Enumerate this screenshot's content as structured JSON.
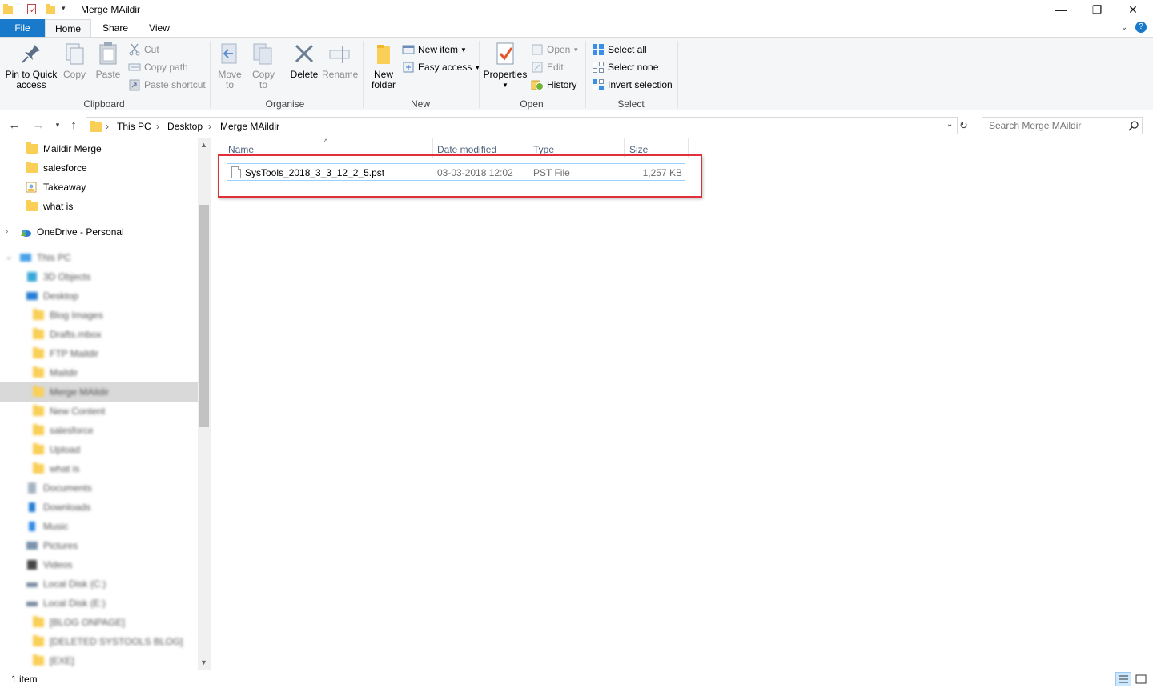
{
  "window": {
    "title": "Merge MAildir",
    "minimize_glyph": "—",
    "maximize_glyph": "❐",
    "close_glyph": "✕"
  },
  "tabs": {
    "file": "File",
    "home": "Home",
    "share": "Share",
    "view": "View"
  },
  "ribbon": {
    "clipboard": {
      "label": "Clipboard",
      "pin": "Pin to Quick access",
      "copy": "Copy",
      "paste": "Paste",
      "cut": "Cut",
      "copy_path": "Copy path",
      "paste_shortcut": "Paste shortcut"
    },
    "organise": {
      "label": "Organise",
      "move_to": "Move to",
      "copy_to": "Copy to",
      "delete": "Delete",
      "rename": "Rename"
    },
    "new": {
      "label": "New",
      "new_folder": "New folder",
      "new_item": "New item",
      "easy_access": "Easy access"
    },
    "open": {
      "label": "Open",
      "properties": "Properties",
      "open": "Open",
      "edit": "Edit",
      "history": "History"
    },
    "select": {
      "label": "Select",
      "select_all": "Select all",
      "select_none": "Select none",
      "invert_selection": "Invert selection"
    }
  },
  "address": {
    "crumbs": [
      "This PC",
      "Desktop",
      "Merge MAildir"
    ],
    "search_placeholder": "Search Merge MAildir"
  },
  "nav_pane": {
    "quick": [
      "Maildir Merge",
      "salesforce",
      "Takeaway",
      "what is"
    ],
    "onedrive": "OneDrive - Personal",
    "this_pc": "This PC",
    "items": [
      "3D Objects",
      "Desktop",
      "Blog Images",
      "Drafts.mbox",
      "FTP Maildir",
      "Maildir",
      "Merge MAildir",
      "New Content",
      "salesforce",
      "Upload",
      "what is",
      "Documents",
      "Downloads",
      "Music",
      "Pictures",
      "Videos",
      "Local Disk (C:)",
      "Local Disk (E:)",
      "[BLOG ONPAGE]",
      "[DELETED SYSTOOLS BLOG]",
      "[EXE]"
    ]
  },
  "columns": {
    "name": "Name",
    "date": "Date modified",
    "type": "Type",
    "size": "Size"
  },
  "files": [
    {
      "name": "SysTools_2018_3_3_12_2_5.pst",
      "date": "03-03-2018 12:02",
      "type": "PST File",
      "size": "1,257 KB"
    }
  ],
  "status": {
    "count": "1 item"
  }
}
